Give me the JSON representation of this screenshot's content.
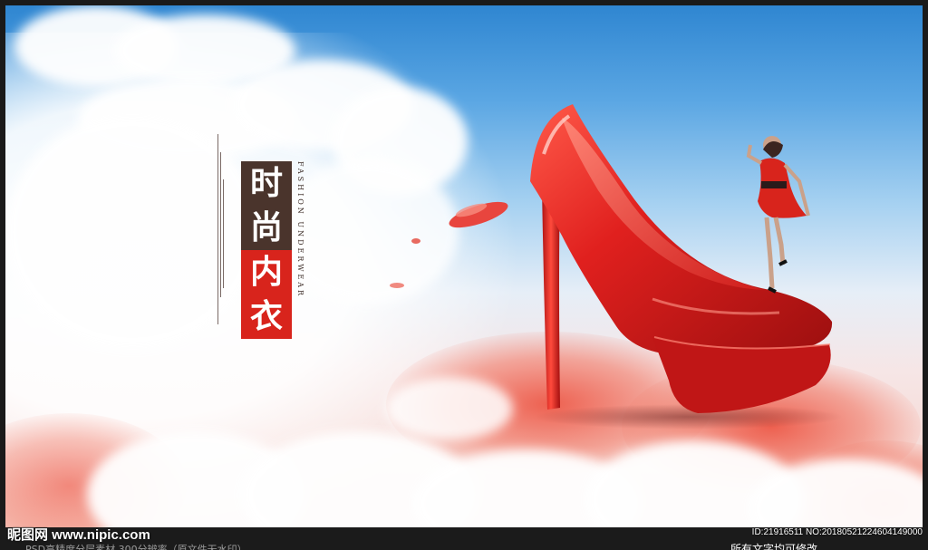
{
  "poster": {
    "title_chars": [
      "时",
      "尚",
      "内",
      "衣"
    ],
    "subtitle_en": "FASHION UNDERWEAR",
    "colors": {
      "title_dark": "#4a342c",
      "title_red": "#d8241c",
      "shoe_red": "#e0201e",
      "sky_top": "#2f86d1"
    },
    "illustration": "red-high-heel-shoe-with-model"
  },
  "watermark": {
    "logo": "昵图网 www.nipic.com",
    "id_text": "ID:21916511 NO:20180521224604149000"
  },
  "footer": {
    "left_text": "PSD高精度分层素材 300分辨率（原文件无水印）",
    "right_text": "所有文字均可修改"
  }
}
